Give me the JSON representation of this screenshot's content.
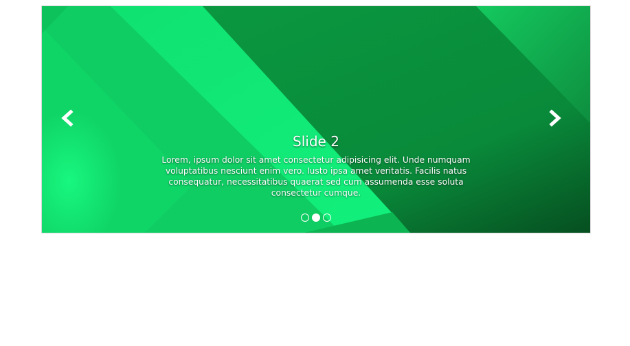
{
  "carousel": {
    "controls": {
      "prev_icon": "chevron-left-icon",
      "next_icon": "chevron-right-icon"
    },
    "slide": {
      "title": "Slide 2",
      "text": "Lorem, ipsum dolor sit amet consectetur adipisicing elit. Unde numquam voluptatibus nesciunt enim vero. Iusto ipsa amet veritatis. Facilis natus consequatur, necessitatibus quaerat sed cum assumenda esse soluta consectetur cumque."
    },
    "indicators": {
      "count": 3,
      "active_index": 2
    },
    "colors": {
      "background_dark": "#0a7f34",
      "background_light": "#14f07a",
      "caption_text": "#ffffff"
    }
  }
}
